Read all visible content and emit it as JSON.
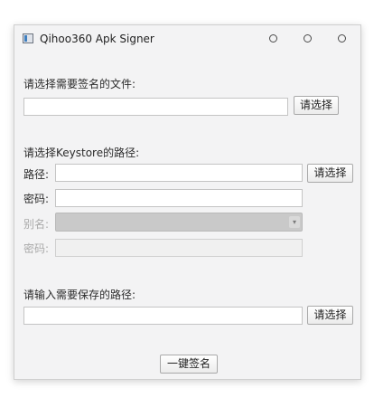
{
  "window": {
    "title": "Qihoo360 Apk Signer",
    "controls": [
      "minimize",
      "maximize",
      "close"
    ]
  },
  "file_section": {
    "label": "请选择需要签名的文件:",
    "value": "",
    "choose_button": "请选择"
  },
  "keystore_section": {
    "heading": "请选择Keystore的路径:",
    "path_label": "路径:",
    "path_value": "",
    "path_button": "请选择",
    "password_label": "密码:",
    "password_value": "",
    "alias_label": "别名:",
    "alias_selected": "",
    "alias_password_label": "密码:",
    "alias_password_value": ""
  },
  "output_section": {
    "label": "请输入需要保存的路径:",
    "value": "",
    "choose_button": "请选择"
  },
  "sign_button": "一键签名"
}
